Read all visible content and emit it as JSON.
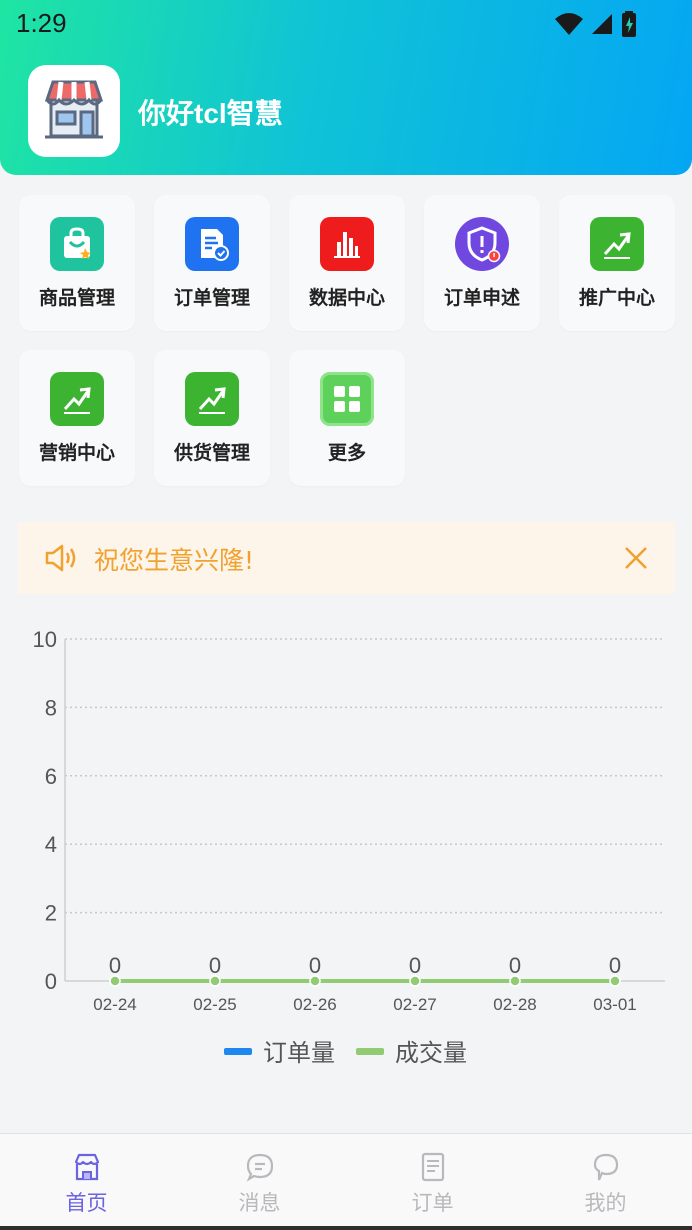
{
  "status_bar": {
    "time": "1:29"
  },
  "header": {
    "greeting": "你好tcl智慧"
  },
  "menu": {
    "items": [
      {
        "label": "商品管理",
        "icon": "shopping-bag-icon",
        "color": "#1fc49e"
      },
      {
        "label": "订单管理",
        "icon": "order-document-icon",
        "color": "#1f73f0"
      },
      {
        "label": "数据中心",
        "icon": "bar-chart-icon",
        "color": "#ee1c1c"
      },
      {
        "label": "订单申述",
        "icon": "shield-alert-icon",
        "color": "#7048e0"
      },
      {
        "label": "推广中心",
        "icon": "trend-up-icon",
        "color": "#3cb431"
      },
      {
        "label": "营销中心",
        "icon": "trend-up-icon",
        "color": "#3cb431"
      },
      {
        "label": "供货管理",
        "icon": "trend-up-icon",
        "color": "#3cb431"
      },
      {
        "label": "更多",
        "icon": "grid-icon",
        "color": "#5ed15a"
      }
    ]
  },
  "notice": {
    "text": "祝您生意兴隆!",
    "color": "#f0a12e"
  },
  "chart_data": {
    "type": "line",
    "categories": [
      "02-24",
      "02-25",
      "02-26",
      "02-27",
      "02-28",
      "03-01"
    ],
    "series": [
      {
        "name": "订单量",
        "color": "#1e88f0",
        "values": [
          0,
          0,
          0,
          0,
          0,
          0
        ]
      },
      {
        "name": "成交量",
        "color": "#91cb74",
        "values": [
          0,
          0,
          0,
          0,
          0,
          0
        ]
      }
    ],
    "y_ticks": [
      "0",
      "2",
      "4",
      "6",
      "8",
      "10"
    ],
    "ylim": [
      0,
      10
    ],
    "grid": true,
    "legend_position": "bottom",
    "data_labels": true
  },
  "tabbar": {
    "active_color": "#6b63e0",
    "tabs": [
      {
        "label": "首页",
        "icon": "home-store-icon",
        "active": true
      },
      {
        "label": "消息",
        "icon": "message-icon",
        "active": false
      },
      {
        "label": "订单",
        "icon": "order-icon",
        "active": false
      },
      {
        "label": "我的",
        "icon": "profile-icon",
        "active": false
      }
    ]
  }
}
